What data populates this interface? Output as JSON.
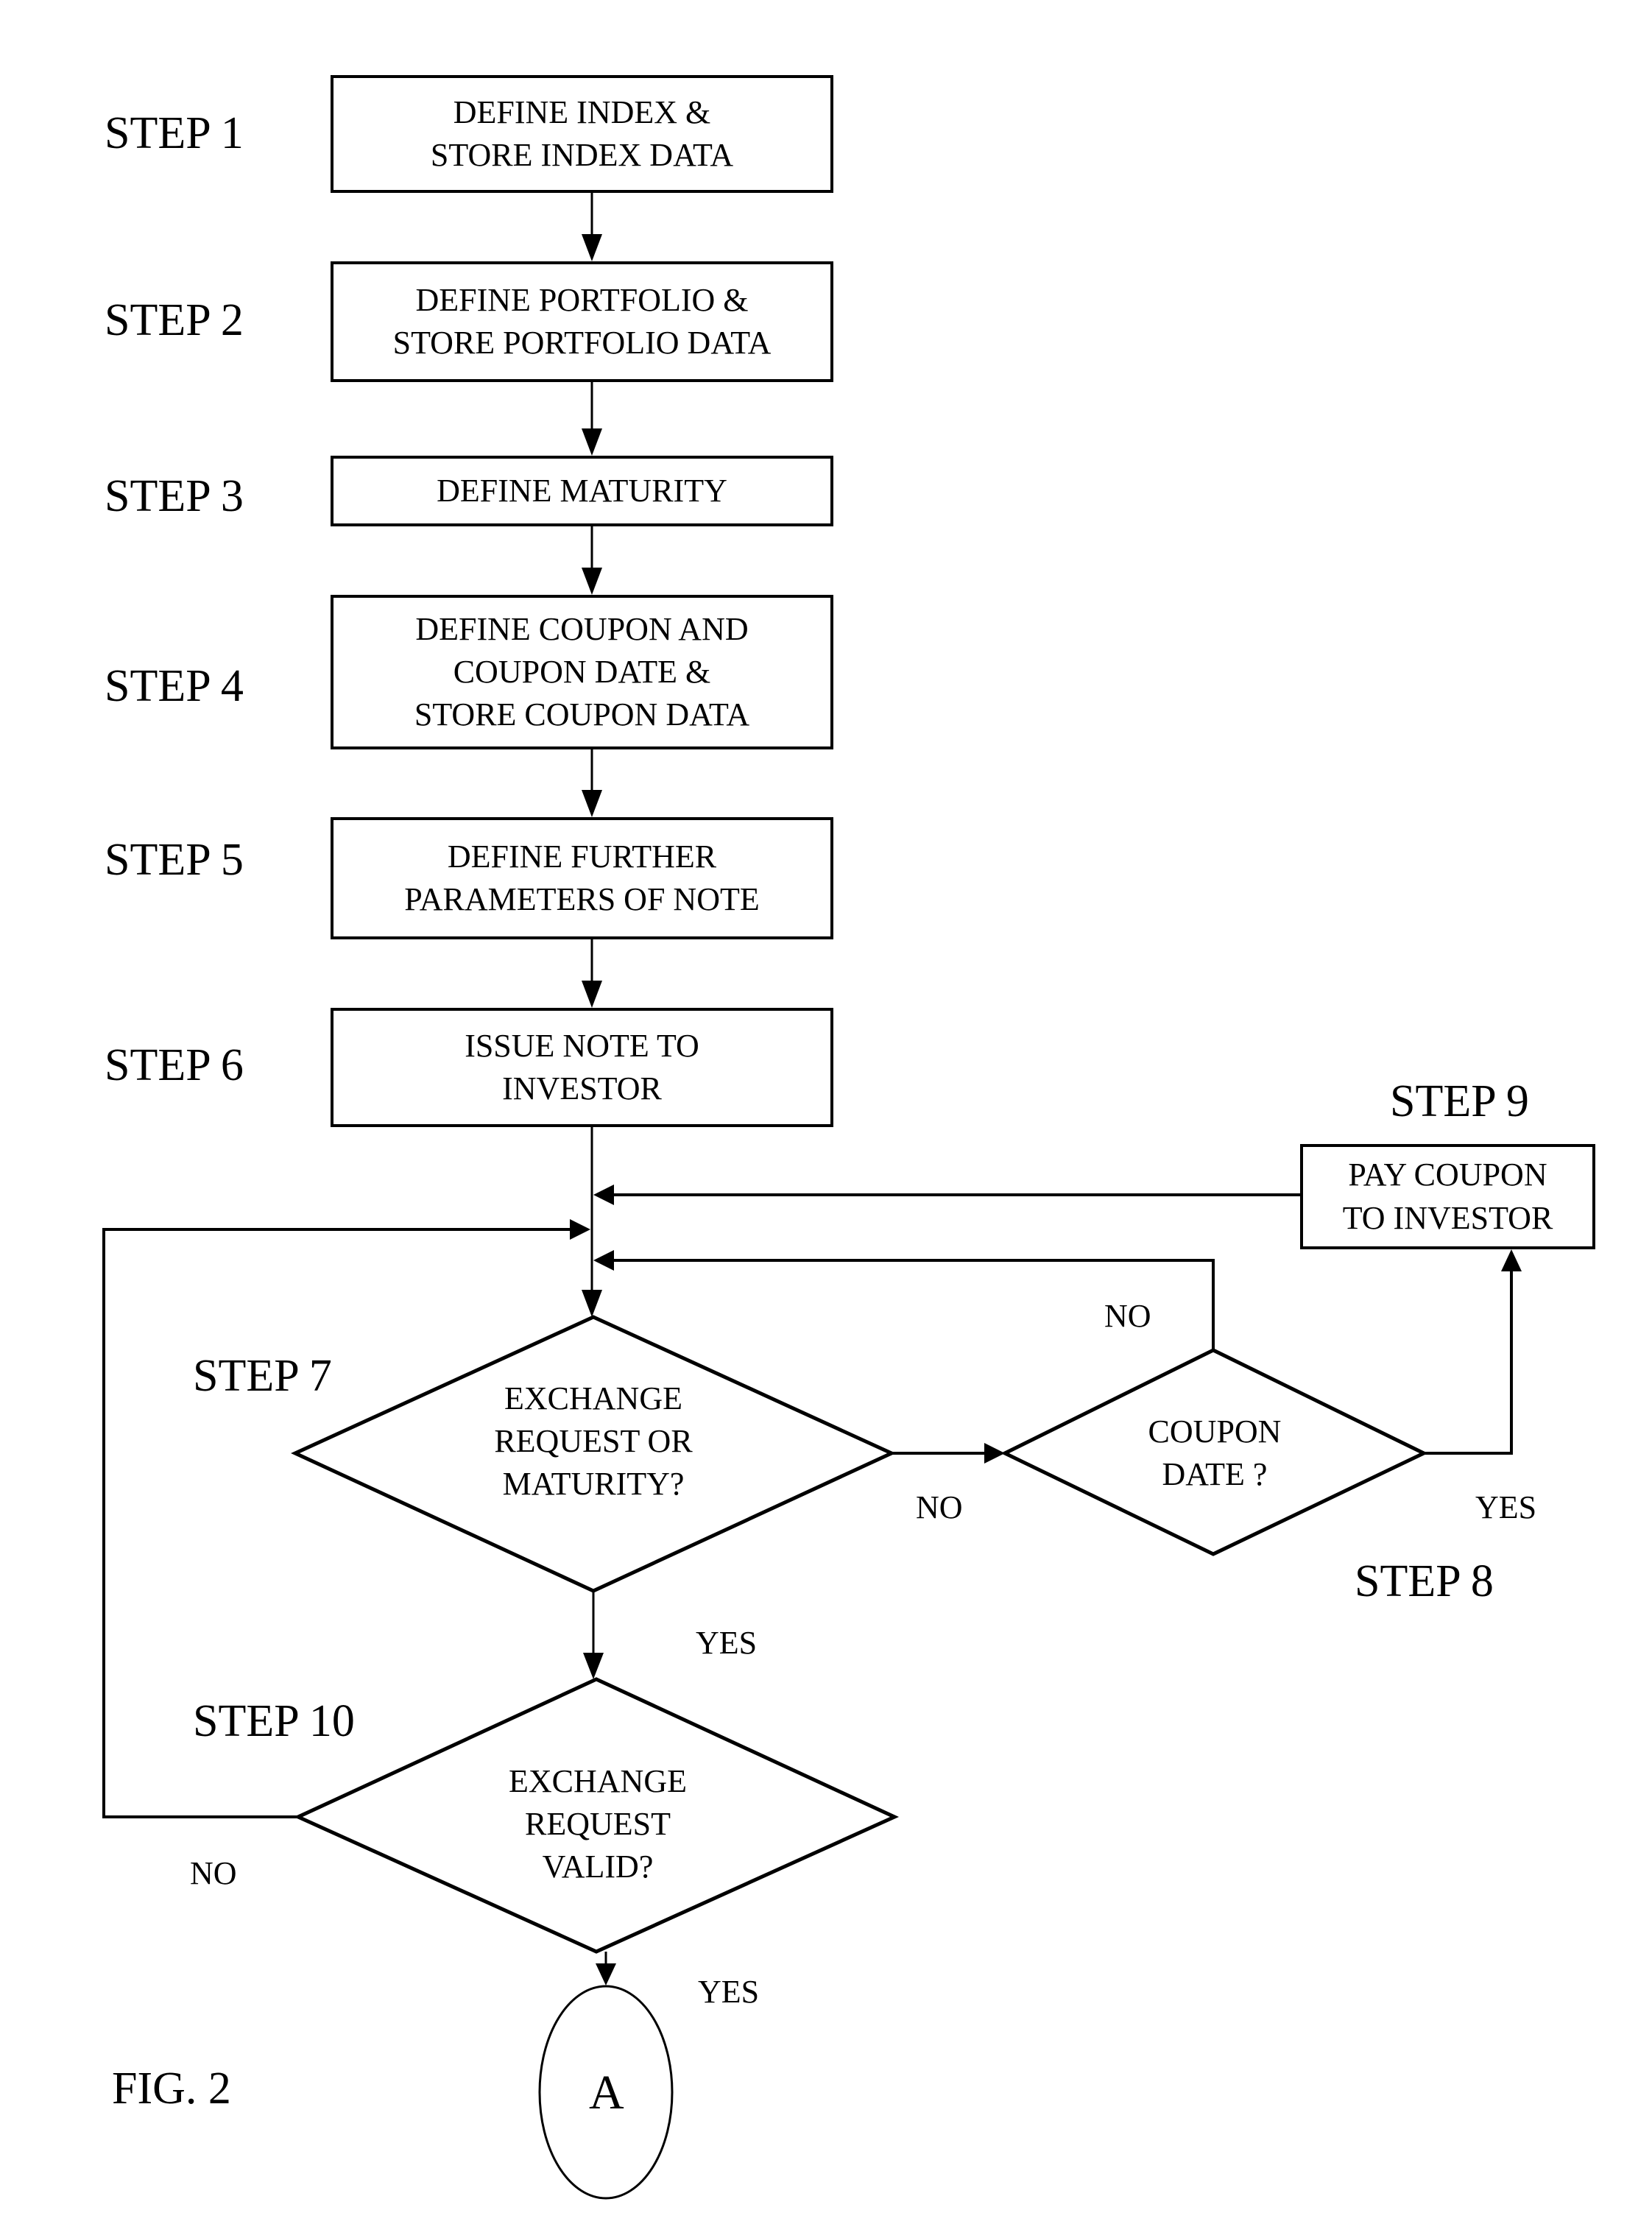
{
  "figure": {
    "title": "FIG. 2",
    "connector_label": "A"
  },
  "steps": [
    {
      "id": "step1",
      "label": "STEP 1",
      "text": [
        "DEFINE INDEX &",
        "STORE INDEX DATA"
      ],
      "shape": "process"
    },
    {
      "id": "step2",
      "label": "STEP 2",
      "text": [
        "DEFINE  PORTFOLIO &",
        "STORE PORTFOLIO DATA"
      ],
      "shape": "process"
    },
    {
      "id": "step3",
      "label": "STEP 3",
      "text": [
        "DEFINE MATURITY"
      ],
      "shape": "process"
    },
    {
      "id": "step4",
      "label": "STEP 4",
      "text": [
        "DEFINE  COUPON AND",
        "COUPON DATE &",
        "STORE COUPON DATA"
      ],
      "shape": "process"
    },
    {
      "id": "step5",
      "label": "STEP 5",
      "text": [
        "DEFINE FURTHER",
        "PARAMETERS OF NOTE"
      ],
      "shape": "process"
    },
    {
      "id": "step6",
      "label": "STEP 6",
      "text": [
        "ISSUE NOTE TO",
        "INVESTOR"
      ],
      "shape": "process"
    },
    {
      "id": "step7",
      "label": "STEP 7",
      "text": [
        "EXCHANGE",
        "REQUEST  OR",
        "MATURITY?"
      ],
      "shape": "decision"
    },
    {
      "id": "step8",
      "label": "STEP 8",
      "text": [
        "COUPON",
        "DATE ?"
      ],
      "shape": "decision"
    },
    {
      "id": "step9",
      "label": "STEP 9",
      "text": [
        "PAY COUPON",
        "TO INVESTOR"
      ],
      "shape": "process"
    },
    {
      "id": "step10",
      "label": "STEP 10",
      "text": [
        "EXCHANGE",
        "REQUEST",
        "VALID?"
      ],
      "shape": "decision"
    }
  ],
  "edges": {
    "step7_no": "NO",
    "step7_yes": "YES",
    "step8_no": "NO",
    "step8_yes": "YES",
    "step10_no": "NO",
    "step10_yes": "YES"
  }
}
